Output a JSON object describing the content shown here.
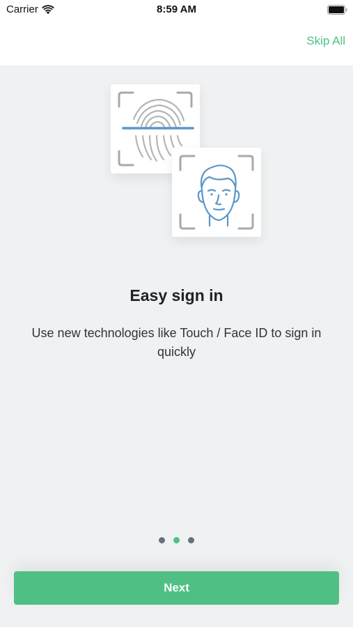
{
  "status_bar": {
    "carrier": "Carrier",
    "time": "8:59 AM"
  },
  "header": {
    "skip_label": "Skip All"
  },
  "illustration": {
    "icons": [
      "fingerprint-icon",
      "face-id-icon"
    ]
  },
  "content": {
    "title": "Easy sign in",
    "subtitle": "Use new technologies like Touch / Face ID to sign in quickly"
  },
  "pagination": {
    "total": 3,
    "active_index": 1
  },
  "footer": {
    "next_label": "Next"
  },
  "colors": {
    "accent": "#4fbf84",
    "background": "#eff1f3",
    "dot_inactive": "#6a7176",
    "illustration_blue": "#5a96c8",
    "frame_gray": "#a8a8a8"
  }
}
